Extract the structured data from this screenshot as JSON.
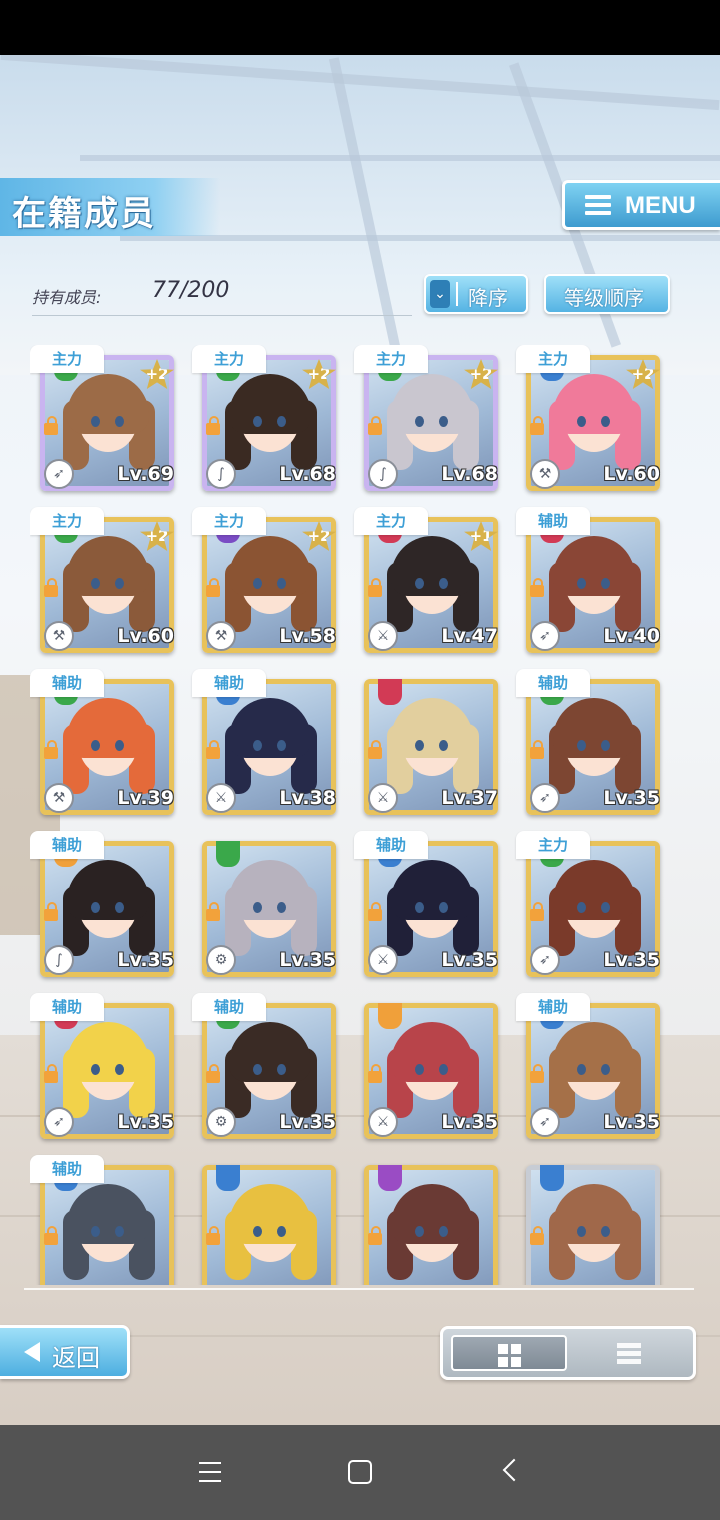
{
  "screen": {
    "title": "在籍成员",
    "menu_label": "MENU",
    "member_count_label": "持有成员:",
    "member_count_value": "77/200",
    "sort_order_label": "降序",
    "sort_key_label": "等级顺序",
    "back_label": "返回",
    "view_mode": "grid"
  },
  "members": [
    {
      "tag": "主力",
      "plus": "+2",
      "level": "Lv.69",
      "frame": "rainbow",
      "attr_color": "#3aa84a",
      "hair": "#9c6b47",
      "weapon": "spear"
    },
    {
      "tag": "主力",
      "plus": "+2",
      "level": "Lv.68",
      "frame": "rainbow",
      "attr_color": "#3aa84a",
      "hair": "#3a2a22",
      "weapon": "whip"
    },
    {
      "tag": "主力",
      "plus": "+2",
      "level": "Lv.68",
      "frame": "rainbow",
      "attr_color": "#3aa84a",
      "hair": "#c9c6cf",
      "weapon": "whip"
    },
    {
      "tag": "主力",
      "plus": "+2",
      "level": "Lv.60",
      "frame": "gold",
      "attr_color": "#3a7fd0",
      "hair": "#f07a9a",
      "weapon": "hammer"
    },
    {
      "tag": "主力",
      "plus": "+2",
      "level": "Lv.60",
      "frame": "gold",
      "attr_color": "#3aa84a",
      "hair": "#8b5a3a",
      "weapon": "hammer"
    },
    {
      "tag": "主力",
      "plus": "+2",
      "level": "Lv.58",
      "frame": "gold",
      "attr_color": "#7a4cc4",
      "hair": "#8b5433",
      "weapon": "hammer"
    },
    {
      "tag": "主力",
      "plus": "+1",
      "level": "Lv.47",
      "frame": "gold",
      "attr_color": "#d23a55",
      "hair": "#2e2626",
      "weapon": "sword"
    },
    {
      "tag": "辅助",
      "plus": "",
      "level": "Lv.40",
      "frame": "gold",
      "attr_color": "#d23a55",
      "hair": "#8a4636",
      "weapon": "spear"
    },
    {
      "tag": "辅助",
      "plus": "",
      "level": "Lv.39",
      "frame": "gold",
      "attr_color": "#3aa84a",
      "hair": "#e46a3a",
      "weapon": "hammer"
    },
    {
      "tag": "辅助",
      "plus": "",
      "level": "Lv.38",
      "frame": "gold",
      "attr_color": "#3a7fd0",
      "hair": "#262a4a",
      "weapon": "sword"
    },
    {
      "tag": "",
      "plus": "",
      "level": "Lv.37",
      "frame": "gold",
      "attr_color": "#d23a55",
      "hair": "#e2cf9e",
      "weapon": "sword"
    },
    {
      "tag": "辅助",
      "plus": "",
      "level": "Lv.35",
      "frame": "gold",
      "attr_color": "#3aa84a",
      "hair": "#7d4632",
      "weapon": "spear"
    },
    {
      "tag": "辅助",
      "plus": "",
      "level": "Lv.35",
      "frame": "gold",
      "attr_color": "#f0a03a",
      "hair": "#2a2222",
      "weapon": "whip"
    },
    {
      "tag": "",
      "plus": "",
      "level": "Lv.35",
      "frame": "gold",
      "attr_color": "#3aa84a",
      "hair": "#b7b2be",
      "weapon": "gear"
    },
    {
      "tag": "辅助",
      "plus": "",
      "level": "Lv.35",
      "frame": "gold",
      "attr_color": "#3a7fd0",
      "hair": "#202038",
      "weapon": "sword"
    },
    {
      "tag": "主力",
      "plus": "",
      "level": "Lv.35",
      "frame": "gold",
      "attr_color": "#3aa84a",
      "hair": "#7a3a2a",
      "weapon": "spear"
    },
    {
      "tag": "辅助",
      "plus": "",
      "level": "Lv.35",
      "frame": "gold",
      "attr_color": "#d23a55",
      "hair": "#f2d24a",
      "weapon": "spear"
    },
    {
      "tag": "辅助",
      "plus": "",
      "level": "Lv.35",
      "frame": "gold",
      "attr_color": "#3aa84a",
      "hair": "#3a2b25",
      "weapon": "gear"
    },
    {
      "tag": "",
      "plus": "",
      "level": "Lv.35",
      "frame": "gold",
      "attr_color": "#f0a03a",
      "hair": "#b8444a",
      "weapon": "sword"
    },
    {
      "tag": "辅助",
      "plus": "",
      "level": "Lv.35",
      "frame": "gold",
      "attr_color": "#3a7fd0",
      "hair": "#a57048",
      "weapon": "spear"
    },
    {
      "tag": "辅助",
      "plus": "",
      "level": "",
      "frame": "gold",
      "attr_color": "#3a7fd0",
      "hair": "#4a5260",
      "weapon": ""
    },
    {
      "tag": "",
      "plus": "",
      "level": "",
      "frame": "gold",
      "attr_color": "#3a7fd0",
      "hair": "#e8c040",
      "weapon": ""
    },
    {
      "tag": "",
      "plus": "",
      "level": "",
      "frame": "gold",
      "attr_color": "#9a4cc4",
      "hair": "#6a3a34",
      "weapon": ""
    },
    {
      "tag": "",
      "plus": "",
      "level": "",
      "frame": "silver",
      "attr_color": "#3a7fd0",
      "hair": "#a0684a",
      "weapon": ""
    }
  ]
}
